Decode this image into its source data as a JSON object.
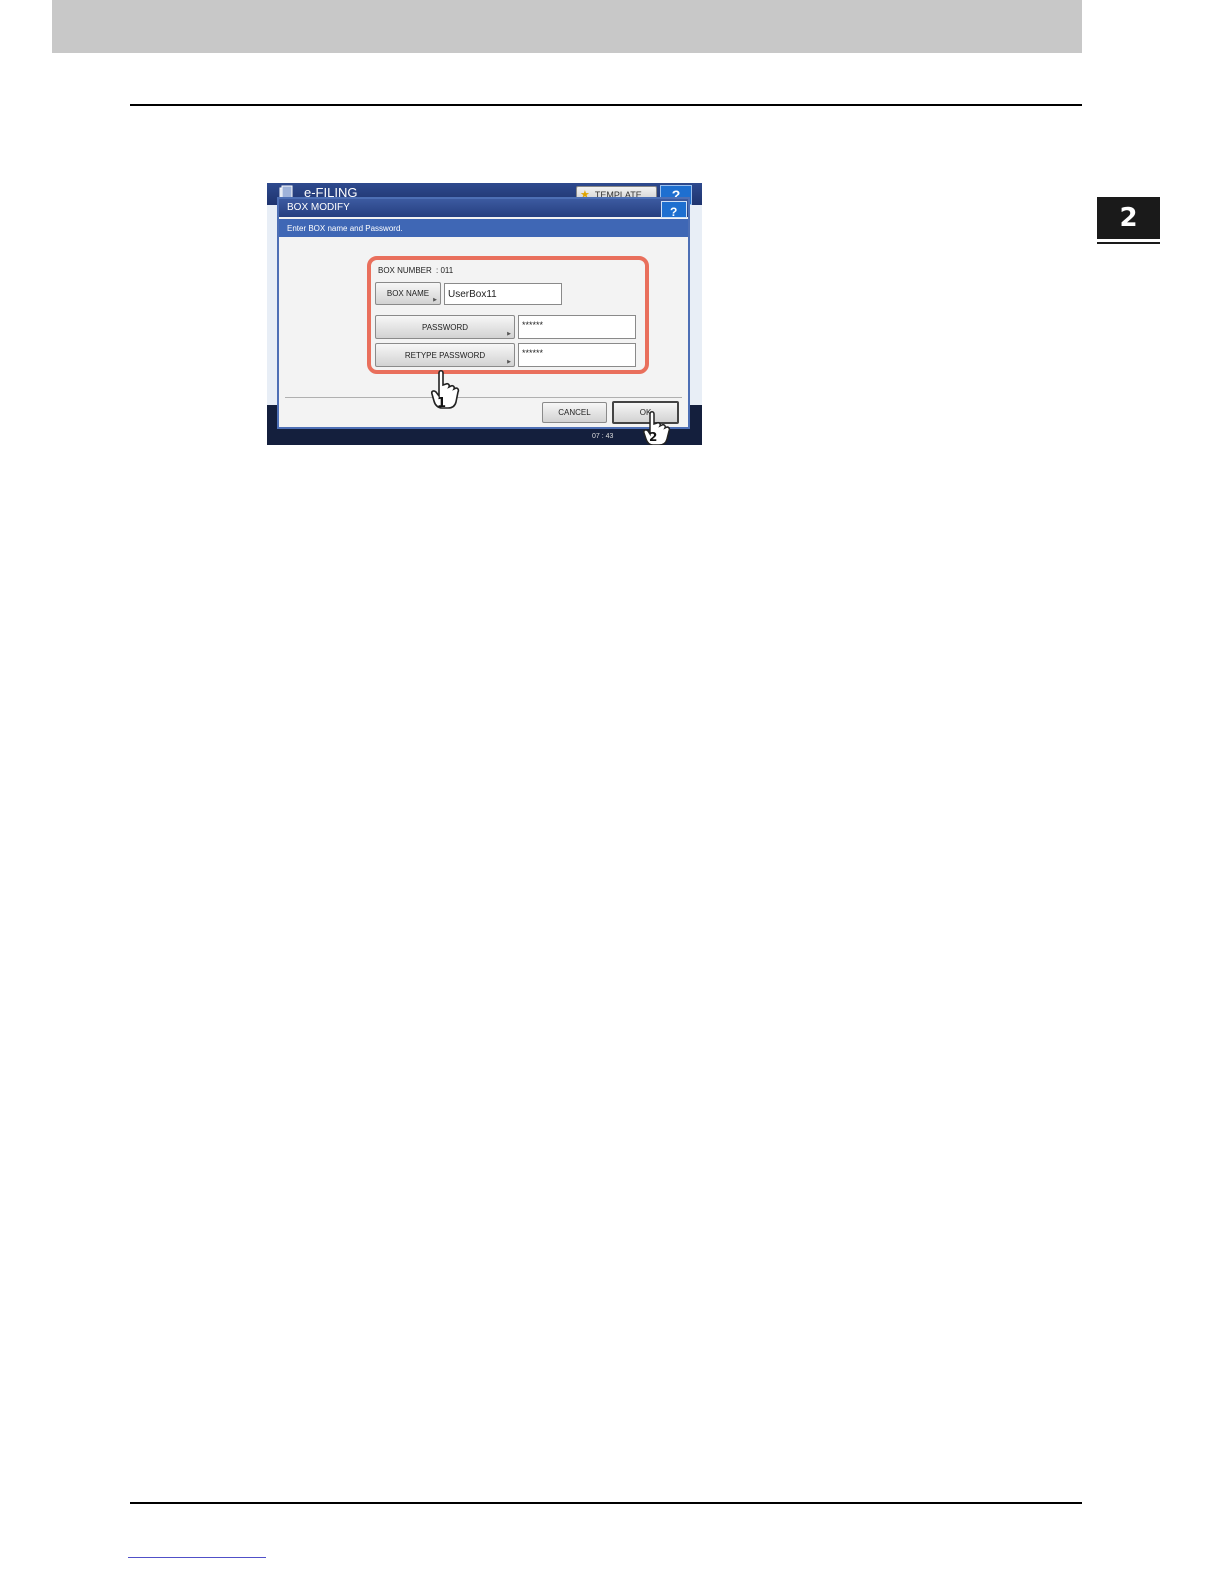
{
  "page": {
    "chapter_number": "2"
  },
  "screen": {
    "app_title": "e-FILING",
    "template_button": "TEMPLATE",
    "help_label": "?",
    "dialog": {
      "title": "BOX MODIFY",
      "help_label": "?",
      "instruction": "Enter BOX name and Password.",
      "box_number_label": "BOX NUMBER",
      "box_number_value": ":  011",
      "box_name_button": "BOX NAME",
      "box_name_value": "UserBox11",
      "password_button": "PASSWORD",
      "password_value": "******",
      "retype_password_button": "RETYPE PASSWORD",
      "retype_password_value": "******",
      "cancel_button": "CANCEL",
      "ok_button": "OK"
    },
    "status_time": "07 : 43",
    "callouts": [
      "1",
      "2"
    ],
    "colors": {
      "highlight": "#e96f5c",
      "title_bar": "#263f80",
      "help_button": "#1e6fd0"
    }
  }
}
